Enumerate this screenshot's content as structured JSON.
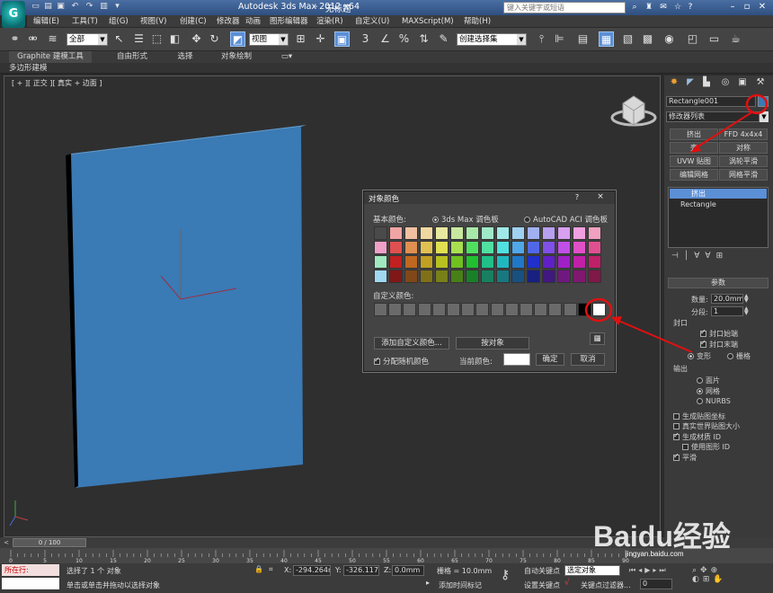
{
  "title": {
    "app": "Autodesk 3ds Max  2012 x64",
    "sep": "-",
    "doc": "无标题"
  },
  "search": {
    "placeholder": "键入关键字或短语"
  },
  "menu": [
    "编辑(E)",
    "工具(T)",
    "组(G)",
    "视图(V)",
    "创建(C)",
    "修改器",
    "动画",
    "图形编辑器",
    "渲染(R)",
    "自定义(U)",
    "MAXScript(M)",
    "帮助(H)"
  ],
  "toolbar": {
    "filter": "全部",
    "refcoord": "视图",
    "namedsel": "创建选择集",
    "snap_label": "3",
    "angle_label": "∠",
    "percent_label": "%"
  },
  "ribbon": {
    "tabs": [
      "Graphite 建模工具",
      "自由形式",
      "选择",
      "对象绘制"
    ],
    "subtab": "多边形建模"
  },
  "viewport": {
    "label": "[ + ][ 正交 ][ 真实 + 边面 ]"
  },
  "dialog": {
    "title": "对象颜色",
    "help": "?",
    "close": "×",
    "basic_label": "基本颜色:",
    "radio_max": "3ds Max 调色板",
    "radio_aci": "AutoCAD ACI 调色板",
    "custom_label": "自定义颜色:",
    "add_custom": "添加自定义颜色...",
    "by_object": "按对象",
    "random": "分配随机颜色",
    "current": "当前颜色:",
    "ok": "确定",
    "cancel": "取消",
    "swatch_rows": [
      [
        "#4a4a4a",
        "#f0a4a4",
        "#f0c0a0",
        "#f0d8a0",
        "#e8e8a0",
        "#c8e8a0",
        "#a8e8a8",
        "#a0e8c8",
        "#a0e8e8",
        "#a0d0f0",
        "#a0b0f0",
        "#b8a0f0",
        "#d8a0f0",
        "#f0a0e0",
        "#f0a0c0"
      ],
      [
        "#f0a0c8",
        "#e05050",
        "#e09050",
        "#e0c050",
        "#e0e050",
        "#a8e050",
        "#50e060",
        "#50e0a0",
        "#50e0e0",
        "#50a8e8",
        "#5068e8",
        "#8050e8",
        "#c050e8",
        "#e050c8",
        "#e05090"
      ],
      [
        "#a0e8c0",
        "#c02020",
        "#c06820",
        "#c0a020",
        "#b8c020",
        "#70c020",
        "#20c030",
        "#20c088",
        "#20b8c0",
        "#2078c8",
        "#2030c8",
        "#6020c8",
        "#a020c8",
        "#c020a8",
        "#c02068"
      ],
      [
        "#a0d8f0",
        "#801818",
        "#804818",
        "#807018",
        "#788018",
        "#488018",
        "#188028",
        "#188060",
        "#187880",
        "#185080",
        "#182080",
        "#401880",
        "#701880",
        "#801870",
        "#801848"
      ]
    ],
    "custom_swatches": [
      "#6a6a6a",
      "#6a6a6a",
      "#6a6a6a",
      "#6a6a6a",
      "#6a6a6a",
      "#6a6a6a",
      "#6a6a6a",
      "#6a6a6a",
      "#6a6a6a",
      "#6a6a6a",
      "#6a6a6a",
      "#6a6a6a",
      "#6a6a6a",
      "#6a6a6a",
      "#000000",
      "#ffffff"
    ],
    "current_color": "#ffffff"
  },
  "cmdpanel": {
    "object_name": "Rectangle001",
    "modlist": "修改器列表",
    "buttons": [
      "挤出",
      "FFD 4x4x4",
      "壳",
      "对称",
      "UVW 贴图",
      "涡轮平滑",
      "编辑网格",
      "网格平滑"
    ],
    "stack": [
      "挤出",
      "Rectangle"
    ],
    "params_title": "参数",
    "amount_label": "数量:",
    "amount_value": "20.0mm",
    "segments_label": "分段:",
    "segments_value": "1",
    "cap_group": "封口",
    "cap_start": "封口始端",
    "cap_end": "封口末端",
    "morph": "变形",
    "grid": "栅格",
    "output_group": "输出",
    "out_patch": "面片",
    "out_mesh": "网格",
    "out_nurbs": "NURBS",
    "gen_coords": "生成贴图坐标",
    "real_world": "真实世界贴图大小",
    "gen_matid": "生成材质 ID",
    "use_shape_id": "使用图形 ID",
    "smooth": "平滑"
  },
  "timeline": {
    "frame": "0 / 100"
  },
  "ruler_ticks": [
    "0",
    "5",
    "10",
    "15",
    "20",
    "25",
    "30",
    "35",
    "40",
    "45",
    "50",
    "55",
    "60",
    "65",
    "70",
    "75",
    "80",
    "85",
    "90"
  ],
  "status": {
    "maxscript": "所在行:",
    "selected": "选择了 1 个 对象",
    "prompt": "单击或单击并拖动以选择对象",
    "x_label": "X:",
    "x_value": "-294.264m",
    "y_label": "Y:",
    "y_value": "-326.117m",
    "z_label": "Z:",
    "z_value": "0.0mm",
    "grid": "栅格 = 10.0mm",
    "add_tag": "添加时间标记",
    "autokey": "自动关键点",
    "selected_obj": "选定对象",
    "setkey": "设置关键点",
    "key_filters": "关键点过滤器...",
    "frame_field": "0"
  },
  "watermark": "Baidu经验",
  "watermark_sub": "jingyan.baidu.com"
}
